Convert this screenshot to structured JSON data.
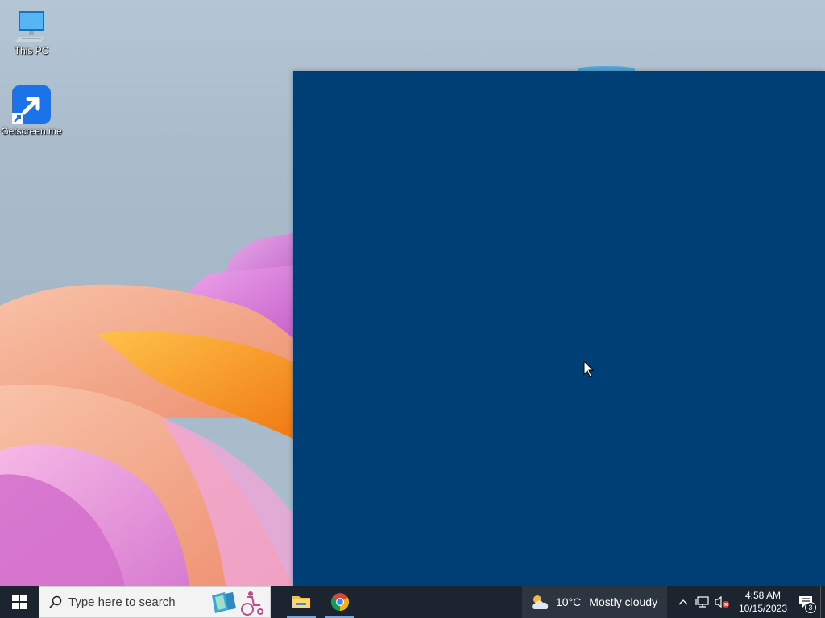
{
  "desktop": {
    "icons": [
      {
        "label": "This PC",
        "icon": "this-pc-icon"
      },
      {
        "label": "Getscreen.me",
        "icon": "shortcut-arrow-icon"
      }
    ]
  },
  "taskbar": {
    "search_placeholder": "Type here to search",
    "pinned": [
      "file-explorer-icon",
      "chrome-icon"
    ],
    "weather": {
      "temperature": "10°C",
      "condition": "Mostly cloudy"
    },
    "clock": {
      "time": "4:58 AM",
      "date": "10/15/2023"
    },
    "notification_count": "3"
  },
  "colors": {
    "window_bg": "#003f75",
    "taskbar_bg": "#1c2430",
    "accent": "#1a73e8"
  }
}
